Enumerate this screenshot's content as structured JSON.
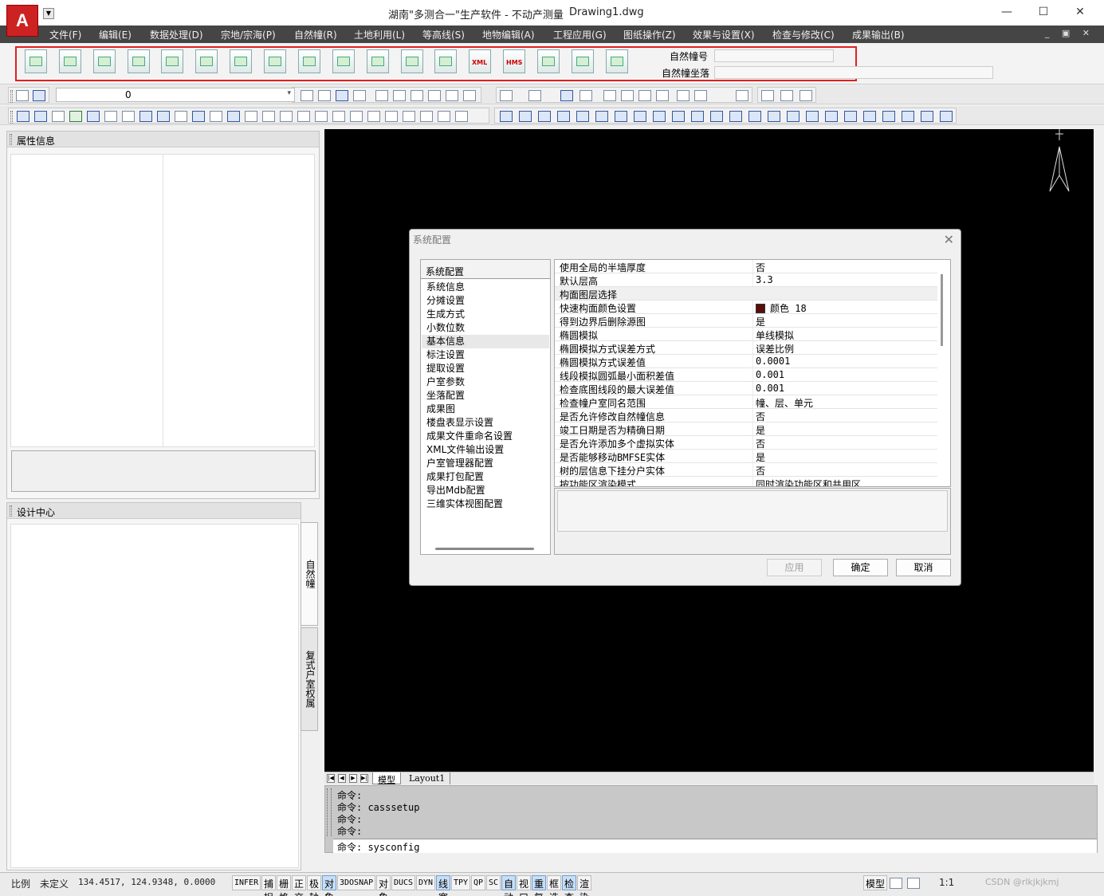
{
  "window": {
    "title": "湖南\"多测合一\"生产软件 - 不动产测量",
    "file": "Drawing1.dwg",
    "logo": "A",
    "minimize": "—",
    "maximize": "☐",
    "close": "✕"
  },
  "menu": [
    "文件(F)",
    "编辑(E)",
    "数据处理(D)",
    "宗地/宗海(P)",
    "自然幢(R)",
    "土地利用(L)",
    "等高线(S)",
    "地物编辑(A)",
    "工程应用(G)",
    "图纸操作(Z)",
    "效果与设置(X)",
    "检查与修改(C)",
    "成果输出(B)"
  ],
  "mdi_controls": "_ ▣ ✕",
  "toolbar": {
    "badges": [
      "XML",
      "HMS"
    ],
    "label_building_no": "自然幢号",
    "label_building_settlement": "自然幢坐落",
    "building_no_value": "",
    "building_settlement_value": ""
  },
  "layer": {
    "name": "0",
    "arrow": "▾"
  },
  "panels": {
    "property_title": "属性信息",
    "design_center_title": "设计中心",
    "side_tab_1": "自然幢",
    "side_tab_2": "复式户室权属"
  },
  "layout_tabs": {
    "nav": [
      "|◀",
      "◀",
      "▶",
      "▶|"
    ],
    "model": "模型",
    "layout1": "Layout1"
  },
  "command_history": [
    "命令:",
    "命令: casssetup",
    "命令:",
    "命令:"
  ],
  "command_current": "命令: sysconfig",
  "status": {
    "scale_label": "比例",
    "scale_value": "未定义",
    "coords": "134.4517, 124.9348, 0.0000",
    "toggles": [
      {
        "label": "INFER",
        "on": false,
        "mono": true
      },
      {
        "label": "捕捉",
        "on": false,
        "mono": false
      },
      {
        "label": "栅格",
        "on": false,
        "mono": false
      },
      {
        "label": "正交",
        "on": false,
        "mono": false
      },
      {
        "label": "极轴",
        "on": false,
        "mono": false
      },
      {
        "label": "对象捕捉",
        "on": true,
        "mono": false
      },
      {
        "label": "3DOSNAP",
        "on": false,
        "mono": true
      },
      {
        "label": "对象追踪",
        "on": false,
        "mono": false
      },
      {
        "label": "DUCS",
        "on": false,
        "mono": true
      },
      {
        "label": "DYN",
        "on": false,
        "mono": true
      },
      {
        "label": "线宽",
        "on": true,
        "mono": false
      },
      {
        "label": "TPY",
        "on": false,
        "mono": true
      },
      {
        "label": "QP",
        "on": false,
        "mono": true
      },
      {
        "label": "SC",
        "on": false,
        "mono": true
      },
      {
        "label": "自动构面",
        "on": true,
        "mono": false
      },
      {
        "label": "视口构面",
        "on": false,
        "mono": false
      },
      {
        "label": "重复构面",
        "on": true,
        "mono": false
      },
      {
        "label": "框选模式",
        "on": false,
        "mono": false
      },
      {
        "label": "检查墙线",
        "on": true,
        "mono": false
      },
      {
        "label": "渲染检查",
        "on": false,
        "mono": false
      }
    ],
    "model": "模型",
    "annotation_scale": "1:1",
    "watermark": "CSDN @rlkjkjkmj"
  },
  "dialog": {
    "title": "系统配置",
    "close": "✕",
    "category_header": "系统配置",
    "categories": [
      "系统信息",
      "分摊设置",
      "生成方式",
      "小数位数",
      "基本信息",
      "标注设置",
      "提取设置",
      "户室参数",
      "坐落配置",
      "成果图",
      "楼盘表显示设置",
      "成果文件重命名设置",
      "XML文件输出设置",
      "户室管理器配置",
      "成果打包配置",
      "导出Mdb配置",
      "三维实体视图配置"
    ],
    "selected_category": "基本信息",
    "properties": [
      {
        "key": "使用全局的半墙厚度",
        "value": "否"
      },
      {
        "key": "默认层高",
        "value": "3.3"
      },
      {
        "key": "构面图层选择",
        "value": ""
      },
      {
        "key": "快速构面颜色设置",
        "value": "颜色 18",
        "swatch": "#5a0e0a"
      },
      {
        "key": "得到边界后删除源图",
        "value": "是"
      },
      {
        "key": "椭圆模拟",
        "value": "单线模拟"
      },
      {
        "key": "椭圆模拟方式误差方式",
        "value": "误差比例"
      },
      {
        "key": "椭圆模拟方式误差值",
        "value": "0.0001"
      },
      {
        "key": "线段模拟圆弧最小面积差值",
        "value": "0.001"
      },
      {
        "key": "检查底图线段的最大误差值",
        "value": "0.001"
      },
      {
        "key": "检查幢户室同名范围",
        "value": "幢、层、单元"
      },
      {
        "key": "是否允许修改自然幢信息",
        "value": "否"
      },
      {
        "key": "竣工日期是否为精确日期",
        "value": "是"
      },
      {
        "key": "是否允许添加多个虚拟实体",
        "value": "否"
      },
      {
        "key": "是否能够移动BMFSE实体",
        "value": "是"
      },
      {
        "key": "树的层信息下挂分户实体",
        "value": "否"
      },
      {
        "key": "按功能区渲染模式",
        "value": "同时渲染功能区和共用区"
      }
    ],
    "buttons": {
      "apply": "应用",
      "ok": "确定",
      "cancel": "取消"
    }
  }
}
